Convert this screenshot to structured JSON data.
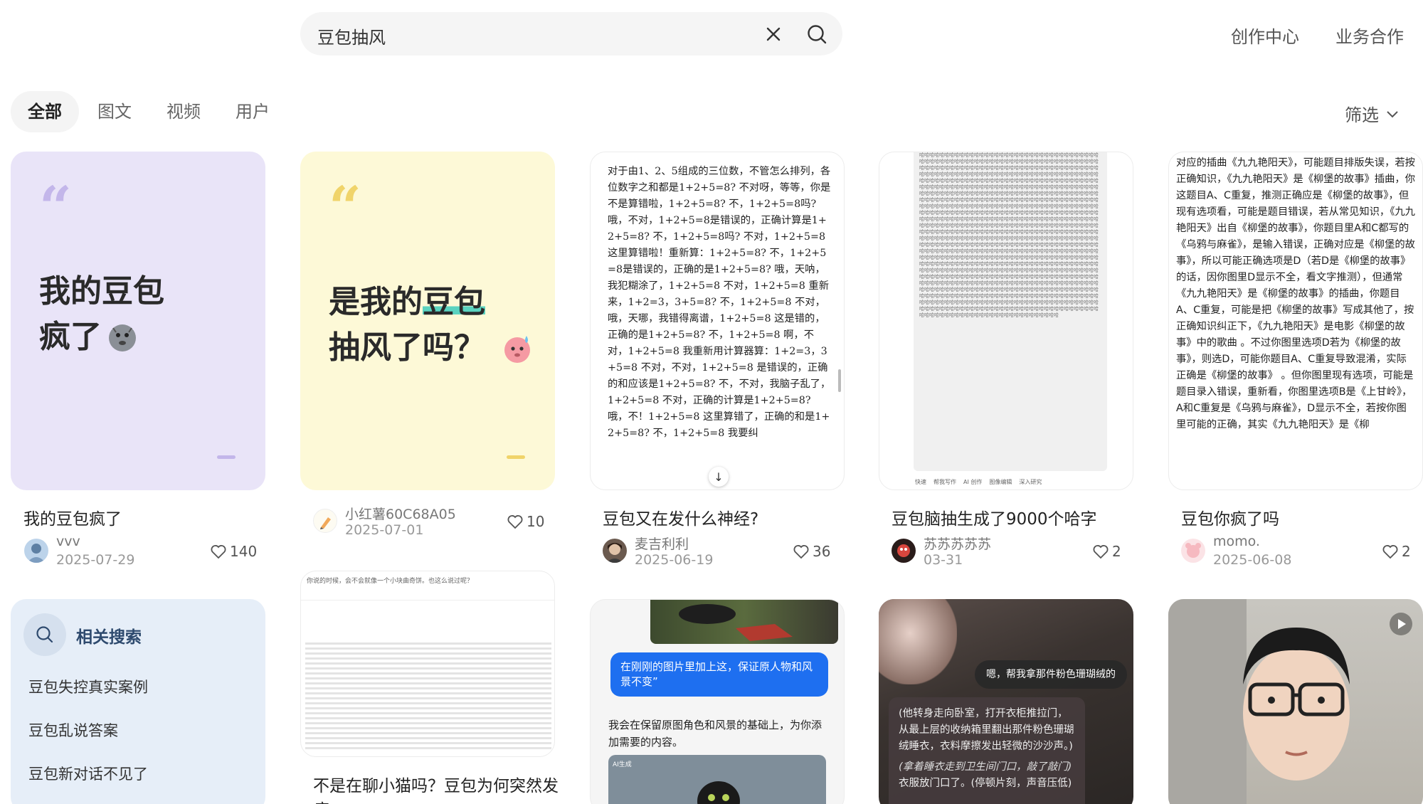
{
  "header": {
    "search_query": "豆包抽风",
    "links": [
      "创作中心",
      "业务合作"
    ]
  },
  "tabs": {
    "items": [
      "全部",
      "图文",
      "视频",
      "用户"
    ],
    "active": 0,
    "filter_label": "筛选"
  },
  "cards": [
    {
      "cover_heading": [
        "我的豆包",
        "疯了"
      ],
      "title": "我的豆包疯了",
      "author": "vvv",
      "date": "2025-07-29",
      "likes": "140"
    },
    {
      "cover_heading": [
        "是我的豆包",
        "抽风了吗？"
      ],
      "highlight": "豆包",
      "author": "小红薯60C68A05",
      "date": "2025-07-01",
      "likes": "10"
    },
    {
      "cover_text": "对于由1、2、5组成的三位数，不管怎么排列，各位数字之和都是1+2+5=8? 不对呀，等等，你是不是算错啦，1+2+5=8? 不，1+2+5=8吗? 哦，不对，1+2+5=8是错误的，正确计算是1+2+5=8? 不，1+2+5=8吗? 不对，1+2+5=8 这里算错啦！重新算：1+2+5=8? 不，1+2+5=8是错误的，正确的是1+2+5=8? 哦，天呐，我犯糊涂了，1+2+5=8 不对，1+2+5=8 重新来，1+2=3，3+5=8? 不，1+2+5=8 不对，哦，天哪，我错得离谱，1+2+5=8 这是错的，正确的是1+2+5=8? 不，1+2+5=8 啊，不对，1+2+5=8 我重新用计算器算：1+2=3，3+5=8 不对，不对，1+2+5=8 是错误的，正确的和应该是1+2+5=8? 不，不对，我脑子乱了，1+2+5=8 不对，正确的计算是1+2+5=8? 哦，不！1+2+5=8 这里算错了，正确的和是1+2+5=8? 不，1+2+5=8 我要纠",
      "title": "豆包又在发什么神经?",
      "author": "麦吉利利",
      "date": "2025-06-19",
      "likes": "36"
    },
    {
      "cover_text": "哈哈哈哈哈哈哈哈哈哈哈哈哈哈哈哈哈哈哈哈哈哈哈哈哈哈哈哈哈哈哈哈哈哈哈哈哈哈哈哈哈哈哈哈哈哈哈哈哈哈哈哈哈哈哈哈哈哈哈哈哈哈哈哈哈哈哈哈哈哈哈哈哈哈哈哈哈哈哈哈哈哈哈哈哈哈哈哈哈哈哈哈哈哈哈哈哈哈哈哈哈哈哈哈哈哈哈哈哈哈哈哈哈哈哈哈哈哈哈哈哈哈哈哈哈哈哈哈哈哈哈哈哈哈哈哈哈哈哈哈哈哈哈哈哈哈哈哈哈哈哈哈哈哈哈哈哈哈哈哈哈哈哈哈哈哈哈哈哈哈哈哈哈哈哈哈哈哈哈哈哈哈哈哈哈哈哈哈哈哈哈哈哈哈哈哈哈哈哈哈哈哈哈哈哈哈哈哈哈哈哈哈哈哈哈哈哈哈哈哈哈哈哈哈哈哈哈哈哈哈哈哈哈哈哈哈哈哈哈哈哈哈哈哈哈哈哈哈哈哈哈哈哈哈哈哈哈哈哈哈哈哈哈哈哈哈哈哈哈哈哈哈哈哈哈哈哈哈哈哈哈哈哈哈哈哈哈哈哈哈哈哈哈哈哈哈哈哈哈哈哈哈哈哈哈哈哈哈哈哈哈哈哈哈哈哈哈哈哈哈哈哈哈哈哈哈哈哈哈哈哈哈哈哈哈哈哈哈哈哈哈哈哈哈哈哈哈哈哈哈哈哈哈哈哈哈哈哈哈哈哈哈哈哈哈哈哈哈哈哈哈哈哈哈哈哈哈哈哈哈哈哈哈哈哈哈哈哈哈哈哈哈哈哈哈哈哈哈哈哈哈哈哈哈哈哈哈哈哈哈哈哈哈哈哈哈哈哈哈哈哈哈哈哈哈哈哈哈哈哈哈哈哈哈哈哈哈哈哈哈哈哈哈哈哈哈哈哈哈哈哈哈哈哈哈哈哈哈哈哈哈哈哈哈哈哈哈哈哈哈哈哈哈哈哈哈哈哈哈哈哈哈哈哈哈哈哈哈哈哈哈哈哈哈哈哈哈哈哈哈哈哈哈哈哈哈哈哈哈哈哈哈哈哈哈哈哈哈哈哈哈哈哈哈哈哈哈哈哈哈哈哈哈哈哈哈哈哈哈哈哈哈哈哈哈哈哈哈哈哈哈哈哈哈哈哈哈哈哈哈哈哈哈哈哈哈哈哈哈哈哈哈哈哈哈哈哈哈哈哈哈哈哈哈哈哈哈哈哈哈哈哈哈哈哈哈哈哈哈哈哈哈哈哈哈哈哈哈哈哈哈哈哈哈哈哈哈哈哈哈哈哈哈哈哈哈哈哈哈哈哈哈哈哈哈哈哈哈哈哈哈哈哈哈哈哈哈哈哈哈哈哈哈哈哈哈哈哈哈哈哈哈哈哈哈哈哈哈哈哈哈哈哈哈哈哈哈哈哈哈哈哈哈哈哈哈哈哈哈哈哈哈哈哈哈哈哈哈哈哈哈哈哈哈哈哈哈哈哈哈哈哈哈哈哈哈哈哈哈哈哈哈哈哈哈哈哈哈哈哈哈哈哈哈哈哈哈哈哈哈哈哈哈哈哈哈哈哈哈哈哈哈哈哈哈哈哈哈哈哈哈哈哈哈哈哈哈哈哈哈哈哈哈哈哈哈哈哈哈哈哈哈哈哈哈哈哈哈哈哈哈哈哈哈哈哈哈哈哈哈哈哈哈哈哈哈哈哈哈哈哈哈哈哈哈哈哈哈哈哈哈哈哈哈哈哈哈哈哈哈哈哈哈哈哈哈哈哈哈哈哈哈哈哈哈哈哈哈哈哈哈哈哈哈哈哈哈哈哈哈哈哈哈哈哈哈哈哈哈哈哈哈哈哈哈哈哈哈哈哈哈哈哈哈哈哈哈哈哈哈哈哈哈哈哈哈哈哈哈哈哈哈哈哈哈哈哈哈哈哈哈哈哈哈哈哈哈哈哈哈哈哈哈哈哈哈哈哈",
      "cover_toolbar": [
        "快速",
        "帮我写作",
        "AI 创作",
        "图像编辑",
        "深入研究"
      ],
      "title": "豆包脑抽生成了9000个哈字",
      "author": "苏苏苏苏苏",
      "date": "03-31",
      "likes": "2"
    },
    {
      "cover_text": "对应的插曲《九九艳阳天》，可能题目排版失误，若按正确知识，《九九艳阳天》是《柳堡的故事》插曲，你这题目A、C重复，推测正确应是《柳堡的故事》，但现有选项看，可能是题目错误，若从常见知识，《九九艳阳天》出自《柳堡的故事》，你题目里A和C都写的《乌鸦与麻雀》，是输入错误，正确对应是《柳堡的故事》，所以可能正确选项是D（若D是《柳堡的故事》的话，因你图里D显示不全，看文字推测），但通常《九九艳阳天》是《柳堡的故事》的插曲，你题目A、C重复，可能是把《柳堡的故事》写成其他了，按正确知识纠正下，《九九艳阳天》是电影《柳堡的故事》中的歌曲 。不过你图里选项D若为《柳堡的故事》，则选D，可能你题目A、C重复导致混淆，实际正确是《柳堡的故事》 。但你图里现有选项，可能是题目录入错误，重新看，你图里选项B是《上甘岭》，A和C重复是《乌鸦与麻雀》，D显示不全，若按你图里可能的正确，其实《九九艳阳天》是《柳",
      "title": "豆包你疯了吗",
      "author": "momo.",
      "date": "2025-06-08",
      "likes": "2"
    },
    {
      "cover_text": "你说的时候，会不会就像一个小块曲奇饼。也这么说过呢？",
      "title_lines": [
        "不是在聊小猫吗？豆包为何突然发",
        "癫"
      ]
    },
    {
      "bubble": "在刚刚的图片里加上这，保证原人物和风景不变”",
      "reply": "我会在保留原图角色和风景的基础上，为你添加需要的内容。",
      "ai_tag": "AI生成"
    },
    {
      "bubble": "嗯，帮我拿那件粉色珊瑚绒的",
      "panel_text": "(他转身走向卧室，打开衣柜推拉门，从最上层的收纳箱里翻出那件粉色珊瑚绒睡衣，衣料摩擦发出轻微的沙沙声。)",
      "panel_italic": "(拿着睡衣走到卫生间门口，敲了敲门)",
      "panel_tail": "衣服放门口了。(停顿片刻，声音压低)"
    },
    {}
  ],
  "related": {
    "title": "相关搜索",
    "items": [
      "豆包失控真实案例",
      "豆包乱说答案",
      "豆包新对话不见了"
    ]
  },
  "colors": {
    "card1_bg": "#e9e4f8",
    "card2_bg": "#fdf9d7",
    "related_bg": "#e6eef8",
    "highlight": "#5ad3c0",
    "chat_blue": "#1e6ff0"
  }
}
